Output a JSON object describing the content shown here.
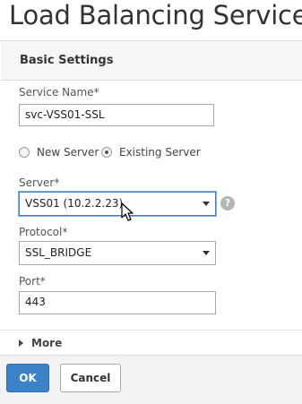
{
  "page": {
    "title": "Load Balancing Service"
  },
  "section": {
    "title": "Basic Settings"
  },
  "fields": {
    "service_name": {
      "label": "Service Name*",
      "value": "svc-VSS01-SSL"
    },
    "server_type": {
      "options": [
        "New Server",
        "Existing Server"
      ],
      "selected": "Existing Server"
    },
    "server": {
      "label": "Server*",
      "value": "VSS01 (10.2.2.23)",
      "help_icon": "question-circle-icon"
    },
    "protocol": {
      "label": "Protocol*",
      "value": "SSL_BRIDGE"
    },
    "port": {
      "label": "Port*",
      "value": "443"
    }
  },
  "more": {
    "label": "More"
  },
  "buttons": {
    "ok": "OK",
    "cancel": "Cancel"
  },
  "colors": {
    "primary_button": "#3b82c8",
    "focus_border": "#3a7fd0"
  }
}
